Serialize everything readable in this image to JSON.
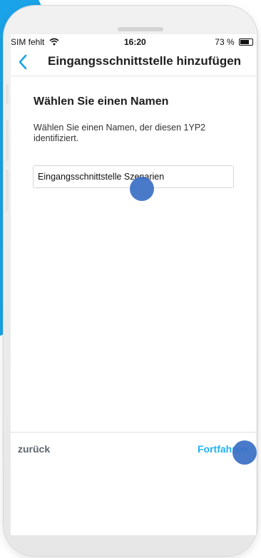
{
  "status_bar": {
    "carrier": "SIM fehlt",
    "wifi_icon": "wifi-icon",
    "time": "16:20",
    "battery": "73 %"
  },
  "header": {
    "back_icon": "chevron-left-icon",
    "title": "Eingangsschnittstelle hinzufügen"
  },
  "main": {
    "heading": "Wählen Sie einen Namen",
    "description": "Wählen Sie einen Namen, der diesen 1YP2 identifiziert.",
    "name_input": {
      "value": "Eingangsschnittstelle Szenarien",
      "placeholder": ""
    }
  },
  "footer": {
    "back_label": "zurück",
    "continue_label": "Fortfahren"
  },
  "colors": {
    "accent": "#20b2f0",
    "background_shape": "#1aa3e8",
    "touch_indicator": "#3a6fc4",
    "footer_back": "#5c6670"
  }
}
